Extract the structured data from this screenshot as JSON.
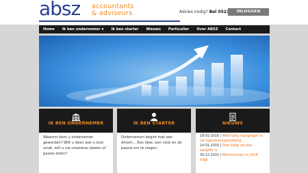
{
  "header": {
    "logo_main": "absz",
    "logo_sub_line1": "accountants",
    "logo_sub_line2": "& adviseurs",
    "advice_label": "Advies nodig? ",
    "advice_phone": "Bel 0523-619315",
    "login_label": "INLOGGEN"
  },
  "nav": {
    "items": [
      {
        "label": "Home"
      },
      {
        "label": "Ik ben ondernemer",
        "has_dropdown": true
      },
      {
        "label": "Ik ben starter"
      },
      {
        "label": "Nieuws"
      },
      {
        "label": "Particulier"
      },
      {
        "label": "Over ABSZ"
      },
      {
        "label": "Contact"
      }
    ]
  },
  "columns": {
    "ondernemer": {
      "icon": "bank-icon",
      "title": "IK BEN ONDERNEMER",
      "text": "Waarom bent u ondernemer geworden? Wilt u doen wat u leuk vindt, wilt u uw creatieve ideeën of passie delen?"
    },
    "starter": {
      "icon": "person-icon",
      "title": "IK BEN STARTER",
      "text": "Ondernemen begint met een droom... Een idee, een visie en de passie om te slagen."
    },
    "nieuws": {
      "icon": "document-icon",
      "title": "NIEUWS",
      "items": [
        {
          "date": "18-01-2016",
          "title": "Meld tijdig wijzigingen in uw eigenwoningrenteling"
        },
        {
          "date": "14-01-2016",
          "title": "Dien tijdig uw btw-aangifte in"
        },
        {
          "date": "30-12-2015",
          "title": "Minimumloon in 2016 stijgt"
        }
      ]
    }
  },
  "colors": {
    "brand_blue": "#2a3f8f",
    "brand_orange": "#f08a24",
    "nav_bg": "#1a1a1a"
  }
}
